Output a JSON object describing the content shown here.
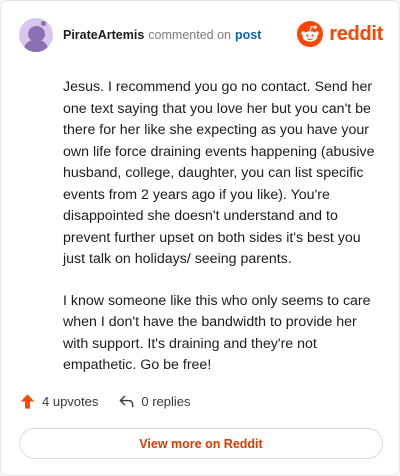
{
  "header": {
    "username": "PirateArtemis",
    "action": "commented on",
    "target": "post",
    "avatar_icon": "snoo-avatar-icon"
  },
  "brand": {
    "wordmark": "reddit",
    "icon": "reddit-logo-icon",
    "color": "#ff4500"
  },
  "comment": {
    "paragraphs": [
      "Jesus. I recommend you go no contact. Send her one text saying that you love her but you can't be there for her like she expecting as you have your own life force draining events happening (abusive husband, college, daughter, you can list specific events from 2 years ago if you like). You're disappointed she doesn't understand and to prevent further upset on both sides it's best you just talk on holidays/ seeing parents.",
      "I know someone like this who only seems to care when I don't have the bandwidth to provide her with support. It's draining and they're not empathetic. Go be free!"
    ]
  },
  "actions": {
    "upvotes": "4 upvotes",
    "replies": "0 replies",
    "upvote_icon": "upvote-arrow-icon",
    "reply_icon": "reply-arrow-icon",
    "upvote_color": "#ff4500"
  },
  "cta": {
    "label": "View more on Reddit",
    "color": "#d93a00"
  }
}
